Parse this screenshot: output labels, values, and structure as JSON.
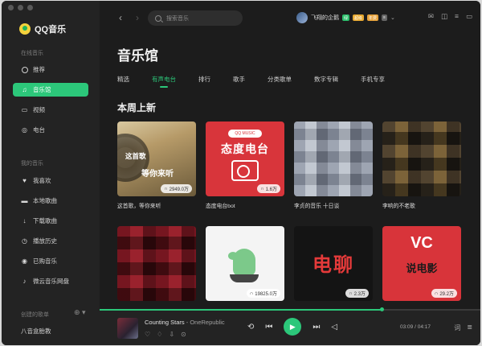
{
  "app": {
    "name": "QQ音乐"
  },
  "sidebar": {
    "section_online": "在线音乐",
    "online_items": [
      {
        "label": "推荐",
        "icon": "compass-icon"
      },
      {
        "label": "音乐馆",
        "icon": "music-note-icon"
      },
      {
        "label": "视频",
        "icon": "video-icon"
      },
      {
        "label": "电台",
        "icon": "radio-icon"
      }
    ],
    "section_mine": "我的音乐",
    "mine_items": [
      {
        "label": "我喜欢",
        "icon": "heart-icon"
      },
      {
        "label": "本地歌曲",
        "icon": "computer-icon"
      },
      {
        "label": "下载歌曲",
        "icon": "download-icon"
      },
      {
        "label": "播放历史",
        "icon": "clock-icon"
      },
      {
        "label": "已购音乐",
        "icon": "purchased-icon"
      },
      {
        "label": "微云音乐网盘",
        "icon": "cloud-note-icon"
      }
    ],
    "section_created": "创建的歌单",
    "created_item": "八音盒胎教"
  },
  "topbar": {
    "search_placeholder": "搜索音乐",
    "username": "飞翔的企鹅",
    "badges": [
      "绿",
      "超级",
      "年费",
      "≡"
    ]
  },
  "page": {
    "title": "音乐馆",
    "tabs": [
      "精选",
      "有声电台",
      "排行",
      "歌手",
      "分类歌单",
      "数字专辑",
      "手机专享"
    ],
    "active_tab": "有声电台",
    "section_title": "本周上新"
  },
  "cards": [
    {
      "name": "这首歌，等你来听",
      "plays": "2949.0万",
      "cover_lines": [
        "这首歌",
        "等你来听"
      ]
    },
    {
      "name": "态度电台bot",
      "plays": "1.6万",
      "cover_title": "态度电台",
      "cover_pill": "QQ MUSIC RADIO"
    },
    {
      "name": "李贞的音乐 十日谈",
      "plays": ""
    },
    {
      "name": "李响的不老歌",
      "plays": ""
    },
    {
      "name": "",
      "plays": ""
    },
    {
      "name": "",
      "plays": "19825.0万"
    },
    {
      "name": "",
      "plays": "2.3万",
      "cover_title": "电聊"
    },
    {
      "name": "",
      "plays": "29.2万",
      "cover_title": "VC",
      "cover_sub": "说电影"
    }
  ],
  "player": {
    "title": "Counting Stars",
    "artist": "OneRepublic",
    "current": "03:09",
    "total": "04:17",
    "progress": 0.74,
    "lyric_label": "词"
  },
  "colors": {
    "accent": "#2cc77a",
    "background": "#1c1c1c",
    "sidebar": "#232323"
  }
}
